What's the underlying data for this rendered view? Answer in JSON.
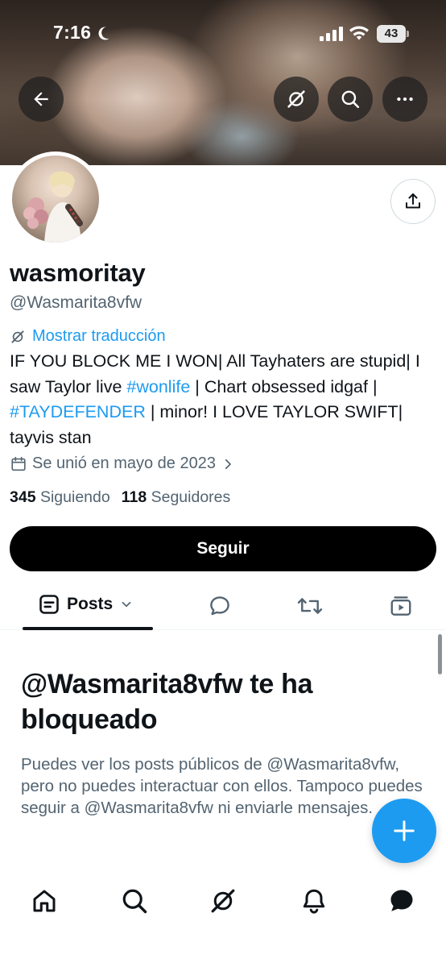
{
  "status_bar": {
    "time": "7:16",
    "battery": "43"
  },
  "header": {
    "back_icon": "arrow-left-icon",
    "grok_icon": "grok-icon",
    "search_icon": "search-icon",
    "more_icon": "more-horizontal-icon"
  },
  "profile": {
    "display_name": "wasmoritay",
    "handle": "@Wasmarita8vfw",
    "translate_label": "Mostrar traducción",
    "bio": {
      "part1": "IF YOU BLOCK ME I WON| All Tayhaters are stupid| I saw Taylor live ",
      "hashtag1": "#wonlife",
      "part2": " | Chart obsessed idgaf | ",
      "hashtag2": "#TAYDEFENDER",
      "part3": " | minor! I LOVE TAYLOR SWIFT| tayvis stan"
    },
    "joined": "Se unió en mayo de 2023",
    "following_count": "345",
    "following_label": "Siguiendo",
    "followers_count": "118",
    "followers_label": "Seguidores",
    "follow_button": "Seguir"
  },
  "tabs": {
    "posts_label": "Posts",
    "items": [
      "posts",
      "replies",
      "reposts",
      "media"
    ]
  },
  "blocked": {
    "title": "@Wasmarita8vfw te ha bloqueado",
    "body": "Puedes ver los posts públicos de @Wasmarita8vfw, pero no puedes interactuar con ellos. Tampoco puedes seguir a @Wasmarita8vfw ni enviarle mensajes."
  },
  "bottom_nav": {
    "items": [
      "home-icon",
      "search-icon",
      "grok-icon",
      "notifications-icon",
      "messages-icon"
    ]
  },
  "colors": {
    "accent": "#1d9bf0",
    "text_primary": "#0f1419",
    "text_secondary": "#536471",
    "button_dark": "#000000"
  }
}
